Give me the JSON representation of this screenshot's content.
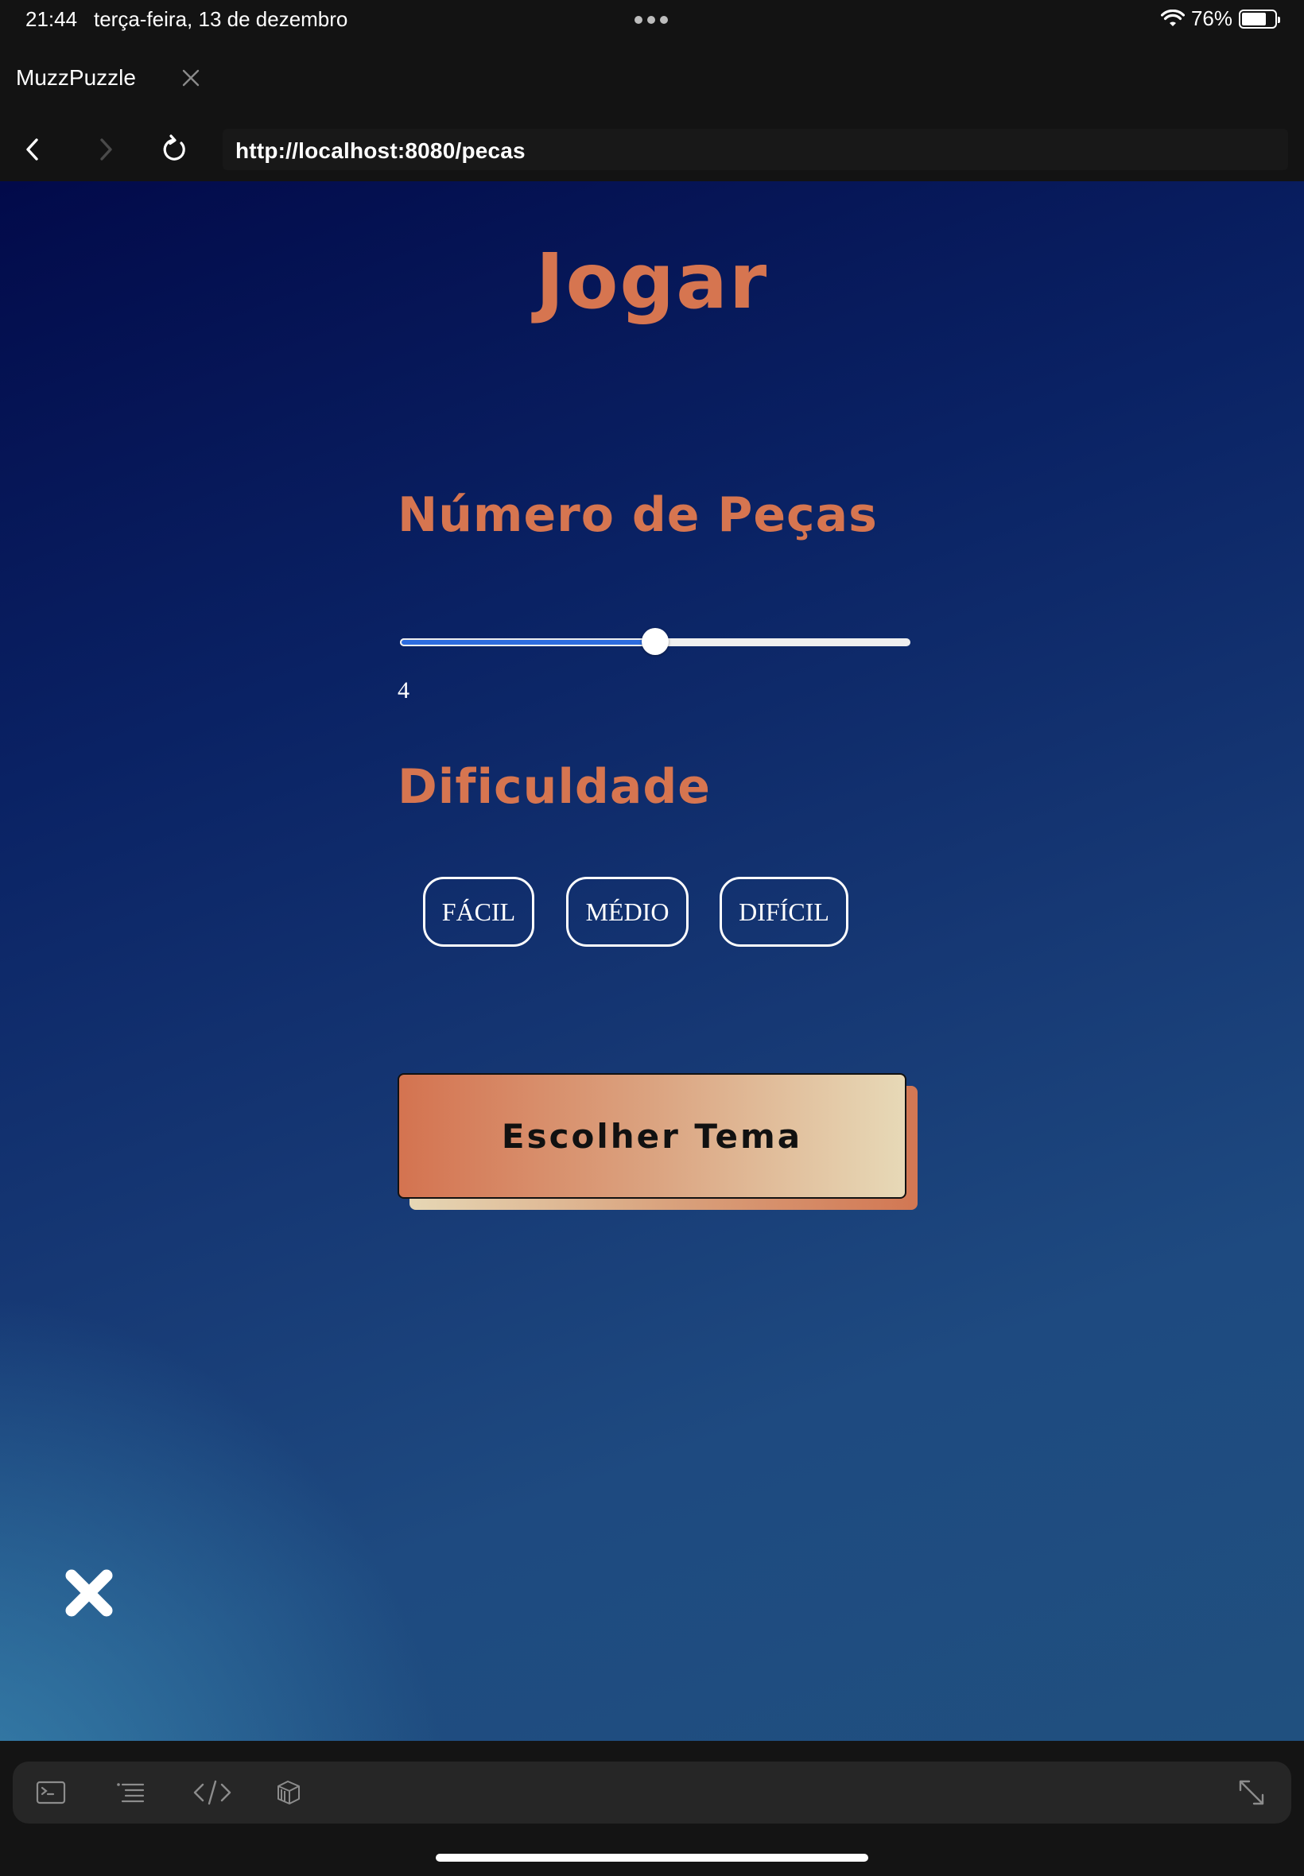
{
  "status_bar": {
    "time": "21:44",
    "date": "terça-feira, 13 de dezembro",
    "battery_percent": "76%",
    "battery_level": 0.76
  },
  "browser": {
    "tab_title": "MuzzPuzzle",
    "url": "http://localhost:8080/pecas"
  },
  "page": {
    "title": "Jogar",
    "pieces_section": {
      "title": "Número de Peças",
      "slider_value": "4",
      "slider_fraction": 0.5
    },
    "difficulty_section": {
      "title": "Dificuldade",
      "buttons": [
        "FÁCIL",
        "MÉDIO",
        "DIFÍCIL"
      ]
    },
    "choose_theme_label": "Escolher Tema"
  },
  "dev_toolbar": {
    "icons": [
      "terminal-icon",
      "list-icon",
      "code-icon",
      "layers-icon",
      "expand-icon"
    ]
  },
  "colors": {
    "accent": "#d67550",
    "slider_fill": "#2d6cdf",
    "background_top": "#020a4a",
    "background_bottom": "#20507f"
  }
}
